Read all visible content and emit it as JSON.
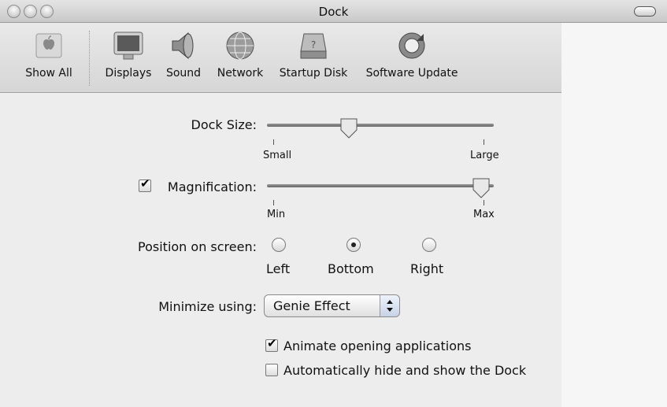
{
  "window": {
    "title": "Dock"
  },
  "toolbar": {
    "items": [
      {
        "label": "Show All",
        "icon": "apple-icon"
      },
      {
        "label": "Displays",
        "icon": "display-icon"
      },
      {
        "label": "Sound",
        "icon": "speaker-icon"
      },
      {
        "label": "Network",
        "icon": "globe-icon"
      },
      {
        "label": "Startup Disk",
        "icon": "hard-disk-icon"
      },
      {
        "label": "Software Update",
        "icon": "update-icon"
      }
    ]
  },
  "dock_size": {
    "label": "Dock Size:",
    "min_label": "Small",
    "max_label": "Large",
    "value": 0.35
  },
  "magnification": {
    "label": "Magnification:",
    "checked": true,
    "min_label": "Min",
    "max_label": "Max",
    "value": 0.98
  },
  "position": {
    "label": "Position on screen:",
    "options": [
      "Left",
      "Bottom",
      "Right"
    ],
    "selected": "Bottom"
  },
  "minimize": {
    "label": "Minimize using:",
    "value": "Genie Effect"
  },
  "options": [
    {
      "label": "Animate opening applications",
      "checked": true
    },
    {
      "label": "Automatically hide and show the Dock",
      "checked": false
    }
  ]
}
